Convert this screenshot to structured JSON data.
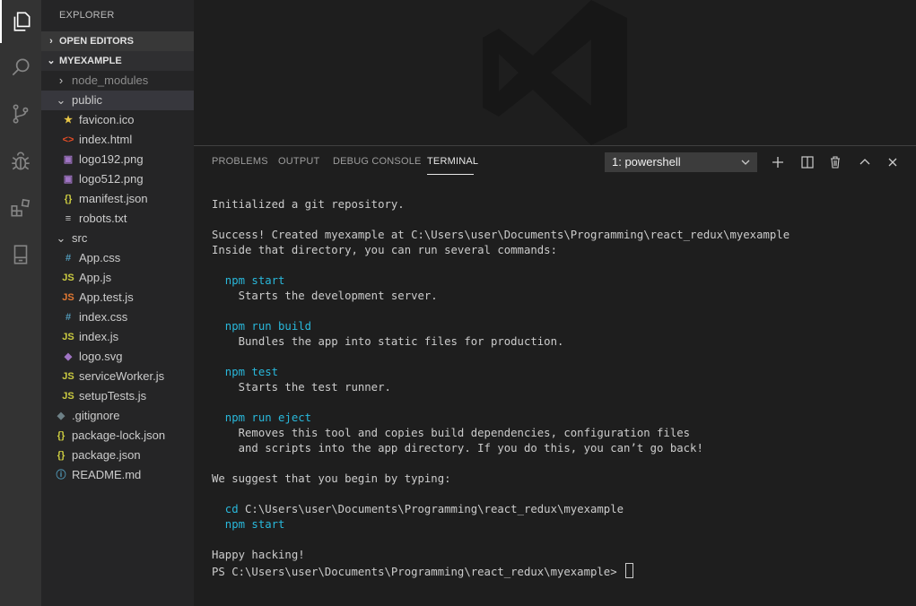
{
  "activity_bar": {
    "items": [
      {
        "icon": "files-icon"
      },
      {
        "icon": "search-icon"
      },
      {
        "icon": "source-control-icon"
      },
      {
        "icon": "debug-icon"
      },
      {
        "icon": "extensions-icon"
      },
      {
        "icon": "remote-explorer-icon"
      }
    ]
  },
  "sidebar": {
    "title": "EXPLORER",
    "open_editors": "OPEN EDITORS",
    "project": "MYEXAMPLE",
    "tree": [
      {
        "label": "node_modules",
        "twist": "right",
        "dim": true
      },
      {
        "label": "public",
        "twist": "down",
        "selected": true
      },
      {
        "label": "favicon.ico",
        "icon": "star-icon",
        "glyph": "★",
        "color": "#e8c646"
      },
      {
        "label": "index.html",
        "icon": "html-icon",
        "glyph": "<>",
        "color": "#e44d26"
      },
      {
        "label": "logo192.png",
        "icon": "image-icon",
        "glyph": "▣",
        "color": "#a074c4"
      },
      {
        "label": "logo512.png",
        "icon": "image-icon",
        "glyph": "▣",
        "color": "#a074c4"
      },
      {
        "label": "manifest.json",
        "icon": "json-icon",
        "glyph": "{}",
        "color": "#cbcb41"
      },
      {
        "label": "robots.txt",
        "icon": "text-icon",
        "glyph": "≡",
        "color": "#c5c5c5"
      },
      {
        "label": "src",
        "twist": "down"
      },
      {
        "label": "App.css",
        "icon": "css-icon",
        "glyph": "#",
        "color": "#519aba"
      },
      {
        "label": "App.js",
        "icon": "js-icon",
        "glyph": "JS",
        "color": "#cbcb41"
      },
      {
        "label": "App.test.js",
        "icon": "test-js-icon",
        "glyph": "JS",
        "color": "#e37933"
      },
      {
        "label": "index.css",
        "icon": "css-icon",
        "glyph": "#",
        "color": "#519aba"
      },
      {
        "label": "index.js",
        "icon": "js-icon",
        "glyph": "JS",
        "color": "#cbcb41"
      },
      {
        "label": "logo.svg",
        "icon": "svg-icon",
        "glyph": "◆",
        "color": "#a074c4"
      },
      {
        "label": "serviceWorker.js",
        "icon": "js-icon",
        "glyph": "JS",
        "color": "#cbcb41"
      },
      {
        "label": "setupTests.js",
        "icon": "js-icon",
        "glyph": "JS",
        "color": "#cbcb41"
      },
      {
        "label": ".gitignore",
        "icon": "git-icon",
        "glyph": "◆",
        "color": "#6d8086"
      },
      {
        "label": "package-lock.json",
        "icon": "json-icon",
        "glyph": "{}",
        "color": "#cbcb41"
      },
      {
        "label": "package.json",
        "icon": "json-icon",
        "glyph": "{}",
        "color": "#cbcb41"
      },
      {
        "label": "README.md",
        "icon": "info-icon",
        "glyph": "ⓘ",
        "color": "#519aba"
      }
    ]
  },
  "panel": {
    "tabs": [
      "PROBLEMS",
      "OUTPUT",
      "DEBUG CONSOLE",
      "TERMINAL"
    ],
    "active_tab": "TERMINAL",
    "terminal_select": "1: powershell"
  },
  "terminal": {
    "lines": [
      {
        "text": "Initialized a git repository."
      },
      {
        "text": ""
      },
      {
        "text": "Success! Created myexample at C:\\Users\\user\\Documents\\Programming\\react_redux\\myexample"
      },
      {
        "text": "Inside that directory, you can run several commands:"
      },
      {
        "text": ""
      },
      {
        "text": "  npm start",
        "style": "cyan"
      },
      {
        "text": "    Starts the development server."
      },
      {
        "text": ""
      },
      {
        "text": "  npm run build",
        "style": "cyan"
      },
      {
        "text": "    Bundles the app into static files for production."
      },
      {
        "text": ""
      },
      {
        "text": "  npm test",
        "style": "cyan"
      },
      {
        "text": "    Starts the test runner."
      },
      {
        "text": ""
      },
      {
        "text": "  npm run eject",
        "style": "cyan"
      },
      {
        "text": "    Removes this tool and copies build dependencies, configuration files"
      },
      {
        "text": "    and scripts into the app directory. If you do this, you can’t go back!"
      },
      {
        "text": ""
      },
      {
        "text": "We suggest that you begin by typing:"
      },
      {
        "text": ""
      },
      {
        "text": "C:\\Users\\user\\Documents\\Programming\\react_redux\\myexample",
        "prefix": "  cd "
      },
      {
        "text": "  npm start",
        "style": "cyan"
      },
      {
        "text": ""
      },
      {
        "text": "Happy hacking!"
      },
      {
        "text": "PS C:\\Users\\user\\Documents\\Programming\\react_redux\\myexample> ",
        "cursor": true
      }
    ]
  },
  "colors": {
    "activity_bg": "#333333",
    "sidebar_bg": "#252526",
    "editor_bg": "#1e1e1e",
    "terminal_cyan": "#29b8db"
  }
}
